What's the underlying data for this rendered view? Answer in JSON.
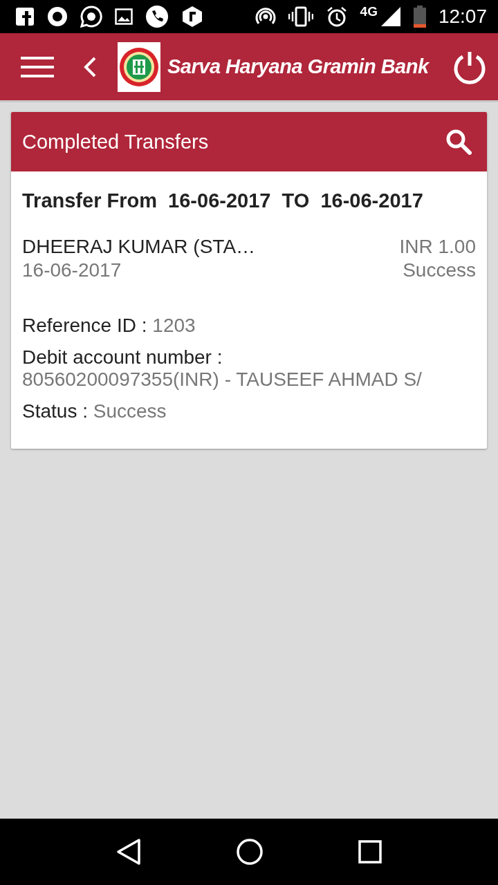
{
  "status_bar": {
    "network": "4G",
    "time": "12:07"
  },
  "app_bar": {
    "title": "Sarva Haryana Gramin Bank"
  },
  "card": {
    "title": "Completed Transfers",
    "range": "Transfer From  16-06-2017  TO  16-06-2017",
    "transfers": [
      {
        "payee": "DHEERAJ KUMAR (STA…",
        "date": "16-06-2017",
        "amount": "INR 1.00",
        "status": "Success"
      }
    ],
    "details": [
      {
        "kind": "inline",
        "label": "Reference ID :",
        "value": "1203"
      },
      {
        "kind": "stacked",
        "label": "Debit account number :",
        "value": "80560200097355(INR) - TAUSEEF AHMAD S/"
      },
      {
        "kind": "inline",
        "label": "Status :",
        "value": "Success"
      }
    ]
  }
}
